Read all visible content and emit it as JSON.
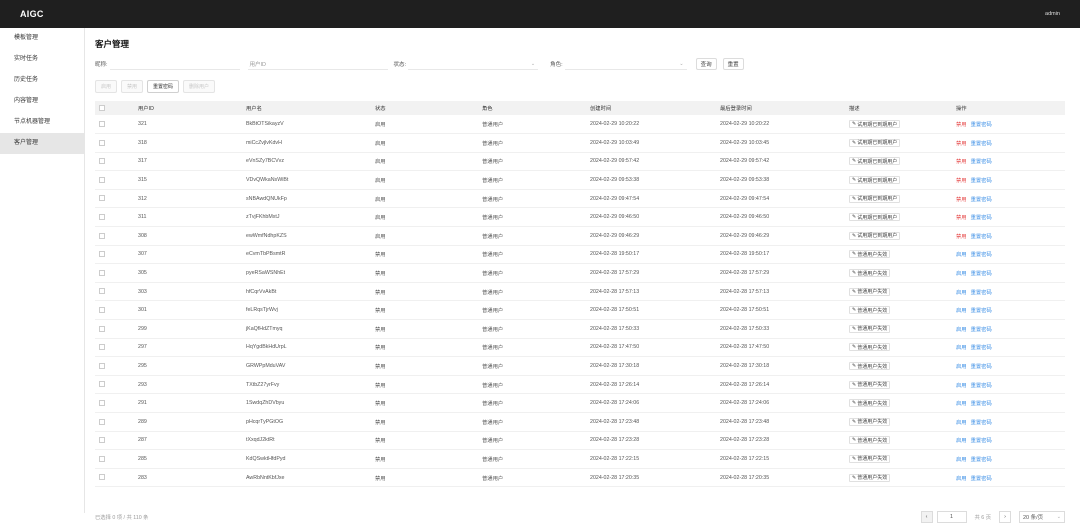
{
  "app": {
    "brand": "AIGC",
    "user": "admin"
  },
  "sidebar": {
    "items": [
      {
        "label": "模板管理",
        "active": false
      },
      {
        "label": "实时任务",
        "active": false
      },
      {
        "label": "历史任务",
        "active": false
      },
      {
        "label": "内容管理",
        "active": false
      },
      {
        "label": "节点机器管理",
        "active": false
      },
      {
        "label": "客户管理",
        "active": true
      }
    ]
  },
  "page": {
    "title": "客户管理"
  },
  "filters": {
    "name_label": "昵称:",
    "userid_label": "用户ID",
    "status_label": "状态:",
    "role_label": "角色:",
    "query": "查询",
    "reset": "重置"
  },
  "actions": {
    "enable": "启用",
    "disable": "禁用",
    "reset_password": "重置密码",
    "delete_user": "删除用户"
  },
  "table": {
    "headers": {
      "userid": "用户ID",
      "username": "用户名",
      "status": "状态",
      "role": "角色",
      "created": "创建时间",
      "last_login": "最后登录时间",
      "desc": "描述",
      "ops": "操作"
    },
    "rows": [
      {
        "id": "321",
        "name": "BkBtOTSikayzV",
        "status": "启用",
        "role": "普通用户",
        "created": "2024-02-29 10:20:22",
        "login": "2024-02-29 10:20:22",
        "desc": "试用期已到期用户",
        "op1": "禁用",
        "op1_red": true,
        "op2": "重置密码"
      },
      {
        "id": "318",
        "name": "miCcZvjlvKdvH",
        "status": "启用",
        "role": "普通用户",
        "created": "2024-02-29 10:03:49",
        "login": "2024-02-29 10:03:45",
        "desc": "试用期已到期用户",
        "op1": "禁用",
        "op1_red": true,
        "op2": "重置密码"
      },
      {
        "id": "317",
        "name": "eVnSZy7BCVvz",
        "status": "启用",
        "role": "普通用户",
        "created": "2024-02-29 09:57:42",
        "login": "2024-02-29 09:57:42",
        "desc": "试用期已到期用户",
        "op1": "禁用",
        "op1_red": true,
        "op2": "重置密码"
      },
      {
        "id": "315",
        "name": "VDvQWkaNsWiBt",
        "status": "启用",
        "role": "普通用户",
        "created": "2024-02-29 09:53:38",
        "login": "2024-02-29 09:53:38",
        "desc": "试用期已到期用户",
        "op1": "禁用",
        "op1_red": true,
        "op2": "重置密码"
      },
      {
        "id": "312",
        "name": "sNBAwdQNUkFp",
        "status": "启用",
        "role": "普通用户",
        "created": "2024-02-29 09:47:54",
        "login": "2024-02-29 09:47:54",
        "desc": "试用期已到期用户",
        "op1": "禁用",
        "op1_red": true,
        "op2": "重置密码"
      },
      {
        "id": "311",
        "name": "zTvjFKhbMxtJ",
        "status": "启用",
        "role": "普通用户",
        "created": "2024-02-29 09:46:50",
        "login": "2024-02-29 09:46:50",
        "desc": "试用期已到期用户",
        "op1": "禁用",
        "op1_red": true,
        "op2": "重置密码"
      },
      {
        "id": "308",
        "name": "ewWmfNdhpKZS",
        "status": "启用",
        "role": "普通用户",
        "created": "2024-02-29 09:46:29",
        "login": "2024-02-29 09:46:29",
        "desc": "试用期已到期用户",
        "op1": "禁用",
        "op1_red": true,
        "op2": "重置密码"
      },
      {
        "id": "307",
        "name": "eCvmTbPBsmtR",
        "status": "禁用",
        "role": "普通用户",
        "created": "2024-02-28 19:50:17",
        "login": "2024-02-28 19:50:17",
        "desc": "普通用户失效",
        "op1": "启用",
        "op1_red": false,
        "op2": "重置密码"
      },
      {
        "id": "305",
        "name": "pyeRSaWSNhEt",
        "status": "禁用",
        "role": "普通用户",
        "created": "2024-02-28 17:57:29",
        "login": "2024-02-28 17:57:29",
        "desc": "普通用户失效",
        "op1": "启用",
        "op1_red": false,
        "op2": "重置密码"
      },
      {
        "id": "303",
        "name": "hfCqrVvAkBt",
        "status": "禁用",
        "role": "普通用户",
        "created": "2024-02-28 17:57:13",
        "login": "2024-02-28 17:57:13",
        "desc": "普通用户失效",
        "op1": "启用",
        "op1_red": false,
        "op2": "重置密码"
      },
      {
        "id": "301",
        "name": "feLRqsTjrWvj",
        "status": "禁用",
        "role": "普通用户",
        "created": "2024-02-28 17:50:51",
        "login": "2024-02-28 17:50:51",
        "desc": "普通用户失效",
        "op1": "启用",
        "op1_red": false,
        "op2": "重置密码"
      },
      {
        "id": "299",
        "name": "jKaQfHdZTmyq",
        "status": "禁用",
        "role": "普通用户",
        "created": "2024-02-28 17:50:33",
        "login": "2024-02-28 17:50:33",
        "desc": "普通用户失效",
        "op1": "启用",
        "op1_red": false,
        "op2": "重置密码"
      },
      {
        "id": "297",
        "name": "HqYgdBkHdUrpL",
        "status": "禁用",
        "role": "普通用户",
        "created": "2024-02-28 17:47:50",
        "login": "2024-02-28 17:47:50",
        "desc": "普通用户失效",
        "op1": "启用",
        "op1_red": false,
        "op2": "重置密码"
      },
      {
        "id": "295",
        "name": "GRWPpMduVAV",
        "status": "禁用",
        "role": "普通用户",
        "created": "2024-02-28 17:30:18",
        "login": "2024-02-28 17:30:18",
        "desc": "普通用户失效",
        "op1": "启用",
        "op1_red": false,
        "op2": "重置密码"
      },
      {
        "id": "293",
        "name": "TXtbZ27yrFvy",
        "status": "禁用",
        "role": "普通用户",
        "created": "2024-02-28 17:26:14",
        "login": "2024-02-28 17:26:14",
        "desc": "普通用户失效",
        "op1": "启用",
        "op1_red": false,
        "op2": "重置密码"
      },
      {
        "id": "291",
        "name": "1SwdqZhDVbyu",
        "status": "禁用",
        "role": "普通用户",
        "created": "2024-02-28 17:24:06",
        "login": "2024-02-28 17:24:06",
        "desc": "普通用户失效",
        "op1": "启用",
        "op1_red": false,
        "op2": "重置密码"
      },
      {
        "id": "289",
        "name": "pHcqrTyPGtOG",
        "status": "禁用",
        "role": "普通用户",
        "created": "2024-02-28 17:23:48",
        "login": "2024-02-28 17:23:48",
        "desc": "普通用户失效",
        "op1": "启用",
        "op1_red": false,
        "op2": "重置密码"
      },
      {
        "id": "287",
        "name": "tXxqdJ2ktRt",
        "status": "禁用",
        "role": "普通用户",
        "created": "2024-02-28 17:23:28",
        "login": "2024-02-28 17:23:28",
        "desc": "普通用户失效",
        "op1": "启用",
        "op1_red": false,
        "op2": "重置密码"
      },
      {
        "id": "285",
        "name": "KdQSwktHfdPyd",
        "status": "禁用",
        "role": "普通用户",
        "created": "2024-02-28 17:22:15",
        "login": "2024-02-28 17:22:15",
        "desc": "普通用户失效",
        "op1": "启用",
        "op1_red": false,
        "op2": "重置密码"
      },
      {
        "id": "283",
        "name": "AwRbNntKbfJxe",
        "status": "禁用",
        "role": "普通用户",
        "created": "2024-02-28 17:20:35",
        "login": "2024-02-28 17:20:35",
        "desc": "普通用户失效",
        "op1": "启用",
        "op1_red": false,
        "op2": "重置密码"
      }
    ]
  },
  "footer": {
    "summary": "已选择 0 项 / 共 110 条",
    "page": "1",
    "total_pages": "共 6 页",
    "page_size": "20 条/页"
  },
  "colors": {
    "topbar": "#1f1f1f",
    "danger": "#e64545",
    "link": "#3a8ee6"
  }
}
